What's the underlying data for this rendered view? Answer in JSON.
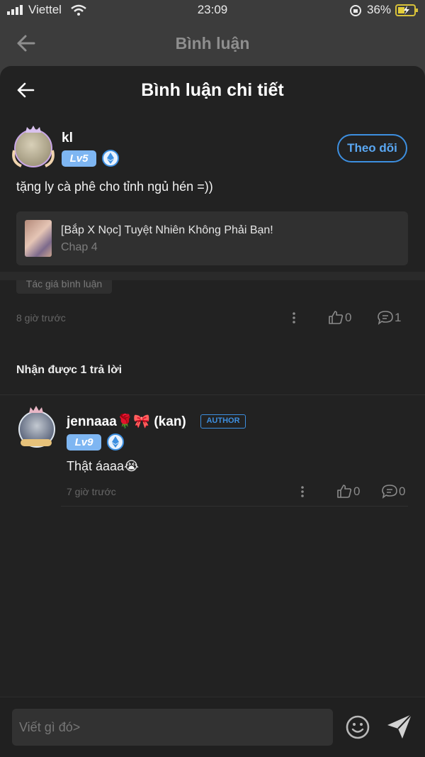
{
  "status_bar": {
    "carrier": "Viettel",
    "time": "23:09",
    "battery": "36%"
  },
  "background_header": {
    "title": "Bình luận"
  },
  "sheet": {
    "title": "Bình luận chi tiết"
  },
  "comment": {
    "username": "kl",
    "level": "Lv5",
    "follow_label": "Theo dõi",
    "text": "tặng ly cà phê cho tỉnh ngủ hén =))",
    "story": {
      "title": "[Bắp X Nọc] Tuyệt Nhiên Không Phải Bạn!",
      "chapter": "Chap 4"
    },
    "author_tag": "Tác giả bình luận",
    "time": "8 giờ trước",
    "likes": "0",
    "replies": "1"
  },
  "replies_heading": "Nhận được 1 trả lời",
  "reply": {
    "username": "jennaaa🌹🎀 (kan)",
    "author_badge": "AUTHOR",
    "level": "Lv9",
    "text": "Thật áaaa😭",
    "time": "7 giờ trước",
    "likes": "0",
    "replies": "0"
  },
  "composer": {
    "placeholder": "Viết gì đó>"
  },
  "colors": {
    "accent": "#3d8fe0",
    "level_badge": "#7eb6f2",
    "sheet_bg": "#222222"
  }
}
